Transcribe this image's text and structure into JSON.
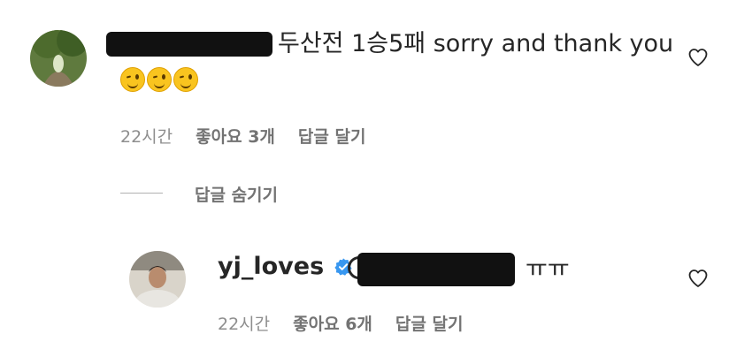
{
  "comment": {
    "text": "두산전 1승5패 sorry and thank you",
    "emoji_count": 3,
    "time": "22시간",
    "likes": "좋아요 3개",
    "reply": "답글 달기"
  },
  "thread": {
    "hide_replies": "답글 숨기기"
  },
  "reply": {
    "username": "yj_loves",
    "verified": true,
    "text": "ㅠㅠ",
    "time": "22시간",
    "likes": "좋아요 6개",
    "reply": "답글 달기"
  },
  "colors": {
    "verified": "#3897f0",
    "secondary_text": "#8e8e8e"
  },
  "icons": [
    "heart-outline-icon",
    "verified-badge-icon"
  ]
}
